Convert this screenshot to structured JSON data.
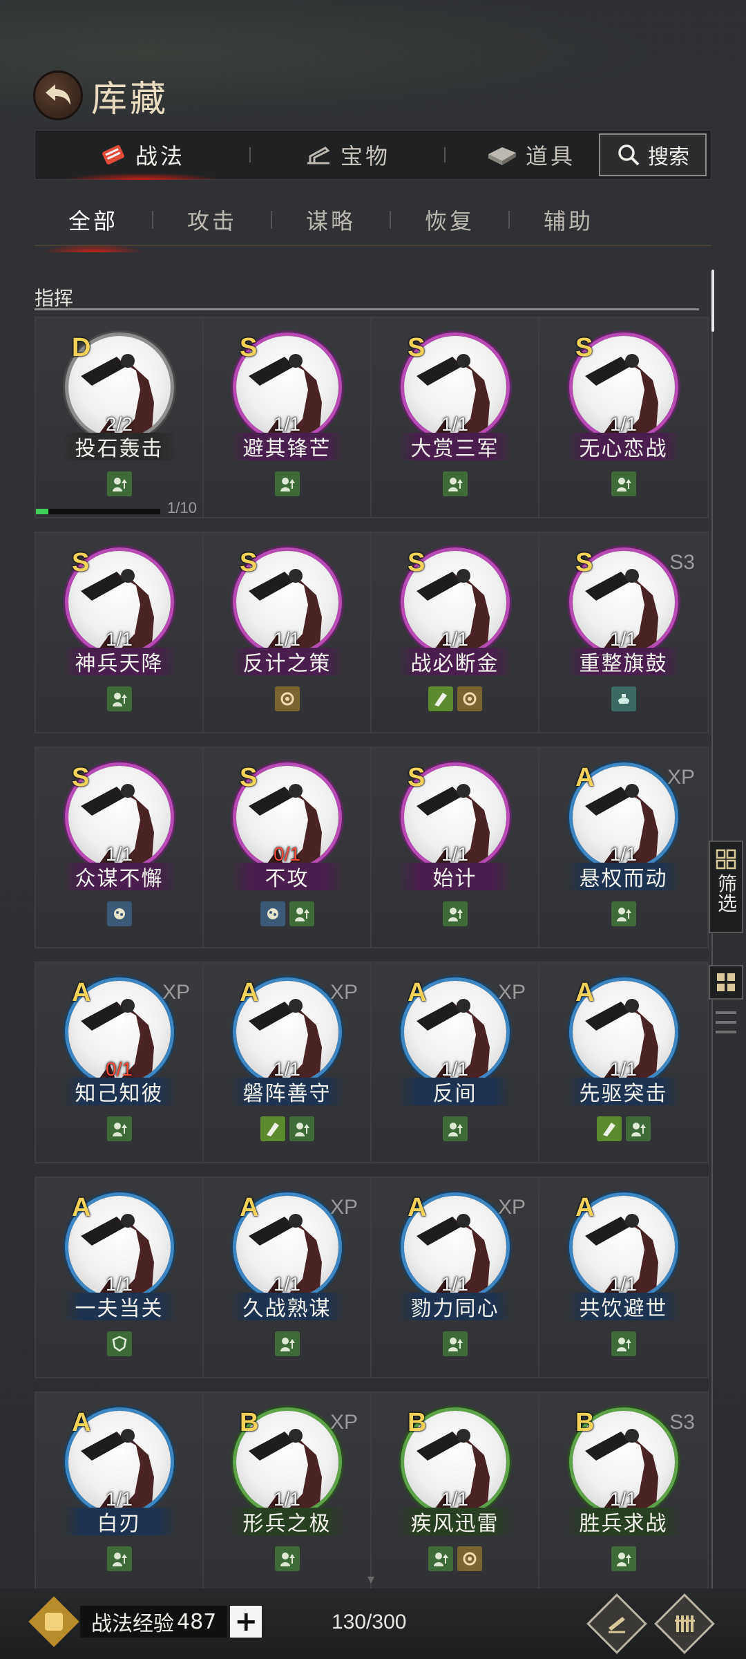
{
  "header": {
    "title": "库藏"
  },
  "main_tabs": [
    {
      "label": "战法",
      "icon": "tactic-scroll-icon",
      "active": true
    },
    {
      "label": "宝物",
      "icon": "treasure-icon",
      "active": false
    },
    {
      "label": "道具",
      "icon": "item-icon",
      "active": false
    }
  ],
  "search": {
    "label": "搜索"
  },
  "sub_tabs": [
    {
      "label": "全部",
      "active": true
    },
    {
      "label": "攻击",
      "active": false
    },
    {
      "label": "谋略",
      "active": false
    },
    {
      "label": "恢复",
      "active": false
    },
    {
      "label": "辅助",
      "active": false
    }
  ],
  "section": {
    "label": "指挥"
  },
  "progress": {
    "text": "1/10",
    "value": 0.1
  },
  "cards": [
    [
      {
        "grade": "D",
        "name": "投石轰击",
        "count": "2/2",
        "count_red": false,
        "tag": "",
        "icons": [
          "up"
        ]
      },
      {
        "grade": "S",
        "name": "避其锋芒",
        "count": "1/1",
        "count_red": false,
        "tag": "",
        "icons": [
          "up"
        ]
      },
      {
        "grade": "S",
        "name": "大赏三军",
        "count": "1/1",
        "count_red": false,
        "tag": "",
        "icons": [
          "up"
        ]
      },
      {
        "grade": "S",
        "name": "无心恋战",
        "count": "1/1",
        "count_red": false,
        "tag": "",
        "icons": [
          "up"
        ]
      }
    ],
    [
      {
        "grade": "S",
        "name": "神兵天降",
        "count": "1/1",
        "count_red": false,
        "tag": "",
        "icons": [
          "up"
        ]
      },
      {
        "grade": "S",
        "name": "反计之策",
        "count": "1/1",
        "count_red": false,
        "tag": "",
        "icons": [
          "hex"
        ]
      },
      {
        "grade": "S",
        "name": "战必断金",
        "count": "1/1",
        "count_red": false,
        "tag": "",
        "icons": [
          "atk",
          "hex"
        ]
      },
      {
        "grade": "S",
        "name": "重整旗鼓",
        "count": "1/1",
        "count_red": false,
        "tag": "S3",
        "icons": [
          "gear"
        ]
      }
    ],
    [
      {
        "grade": "S",
        "name": "众谋不懈",
        "count": "1/1",
        "count_red": false,
        "tag": "",
        "icons": [
          "ast"
        ]
      },
      {
        "grade": "S",
        "name": "不攻",
        "count": "0/1",
        "count_red": true,
        "tag": "",
        "icons": [
          "ast",
          "up"
        ]
      },
      {
        "grade": "S",
        "name": "始计",
        "count": "1/1",
        "count_red": false,
        "tag": "",
        "icons": [
          "up"
        ]
      },
      {
        "grade": "A",
        "name": "悬权而动",
        "count": "1/1",
        "count_red": false,
        "tag": "XP",
        "icons": [
          "up"
        ]
      }
    ],
    [
      {
        "grade": "A",
        "name": "知己知彼",
        "count": "0/1",
        "count_red": true,
        "tag": "XP",
        "icons": [
          "up"
        ]
      },
      {
        "grade": "A",
        "name": "磐阵善守",
        "count": "1/1",
        "count_red": false,
        "tag": "XP",
        "icons": [
          "atk",
          "up"
        ]
      },
      {
        "grade": "A",
        "name": "反间",
        "count": "1/1",
        "count_red": false,
        "tag": "XP",
        "icons": [
          "up"
        ]
      },
      {
        "grade": "A",
        "name": "先驱突击",
        "count": "1/1",
        "count_red": false,
        "tag": "",
        "icons": [
          "atk",
          "up"
        ]
      }
    ],
    [
      {
        "grade": "A",
        "name": "一夫当关",
        "count": "1/1",
        "count_red": false,
        "tag": "",
        "icons": [
          "shd"
        ]
      },
      {
        "grade": "A",
        "name": "久战熟谋",
        "count": "1/1",
        "count_red": false,
        "tag": "XP",
        "icons": [
          "up"
        ]
      },
      {
        "grade": "A",
        "name": "勠力同心",
        "count": "1/1",
        "count_red": false,
        "tag": "XP",
        "icons": [
          "up"
        ]
      },
      {
        "grade": "A",
        "name": "共饮避世",
        "count": "1/1",
        "count_red": false,
        "tag": "",
        "icons": [
          "up"
        ]
      }
    ],
    [
      {
        "grade": "A",
        "name": "白刃",
        "count": "1/1",
        "count_red": false,
        "tag": "",
        "icons": [
          "up"
        ]
      },
      {
        "grade": "B",
        "name": "形兵之极",
        "count": "1/1",
        "count_red": false,
        "tag": "XP",
        "icons": [
          "up"
        ]
      },
      {
        "grade": "B",
        "name": "疾风迅雷",
        "count": "1/1",
        "count_red": false,
        "tag": "",
        "icons": [
          "up",
          "hex"
        ]
      },
      {
        "grade": "B",
        "name": "胜兵求战",
        "count": "1/1",
        "count_red": false,
        "tag": "S3",
        "icons": [
          "up"
        ]
      }
    ]
  ],
  "side": {
    "filter_label": "筛选"
  },
  "bottom": {
    "exp_label": "战法经验",
    "exp_value": "487",
    "plus": "+",
    "capacity": "130/300"
  }
}
